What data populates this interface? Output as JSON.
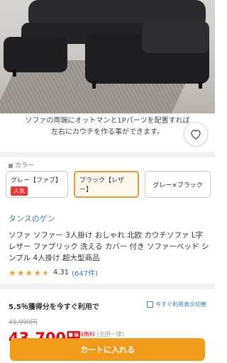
{
  "hero": {
    "image_alt": "black L-shaped leather sofa with ottoman on a gray shag rug",
    "caption_line1": "ソファの両端にオットマンと1Pパーツを配置すれば",
    "caption_line2": "左右にカウチを作る事ができます。"
  },
  "favorite": {
    "icon": "heart-icon"
  },
  "color": {
    "label": "カラー",
    "options": [
      {
        "label": "グレー【ファブ】",
        "badge": "人気"
      },
      {
        "label": "ブラック【レザー】"
      },
      {
        "label": "グレー×ブラック"
      }
    ],
    "selected_index": 1,
    "accent": "#e89a3c"
  },
  "shop_name": "タンスのゲン",
  "product_title": "ソファ ソファー 3人掛け おしゃれ 北欧 カウチソファ L字 レザー ファブリック 洗える カバー 付き ソファーベッド シンプル 4人掛け 超大型商品",
  "rating": {
    "score": "4.31",
    "count": "(647件)",
    "stars": 4.5
  },
  "points": {
    "text": "5.5％獲得分を今すぐ利用で",
    "link": "今すぐ利用表示切替"
  },
  "price": {
    "old": "45,999円",
    "current": "43,700円",
    "shipping": "送料無料",
    "shipping_sub": "(全国一律)",
    "color": "#e60012"
  },
  "cart_button": {
    "label": "カートに入れる",
    "color": "#f29a1a"
  }
}
